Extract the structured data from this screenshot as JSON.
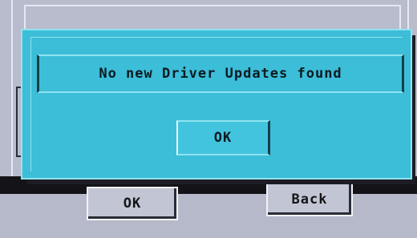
{
  "alert": {
    "message": "No new Driver Updates found",
    "ok_label": "OK"
  },
  "background_dialog": {
    "ok_label": "OK",
    "back_label": "Back"
  },
  "colors": {
    "alert_background": "#3cbdd8",
    "dialog_background": "#b8bccd",
    "text": "#0d1a20"
  }
}
